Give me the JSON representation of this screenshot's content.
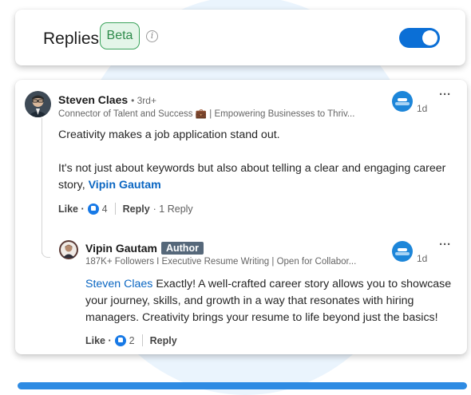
{
  "replies": {
    "title": "Replies",
    "badge": "Beta",
    "info_icon": "info-icon",
    "toggle_on": true,
    "toggle_color": "#0b6fd6"
  },
  "comment": {
    "author": "Steven Claes",
    "degree": "• 3rd+",
    "headline": "Connector of Talent and Success 💼 | Empowering Businesses to Thriv...",
    "time": "1d",
    "more": "···",
    "text_1": "Creativity makes a job application stand out.",
    "text_2": "It's not just about keywords but also about telling a clear and engaging career story,",
    "mention": "Vipin Gautam",
    "like_label": "Like ·",
    "like_count": "4",
    "reply_label": "Reply",
    "reply_count": "· 1 Reply"
  },
  "reply": {
    "author": "Vipin Gautam",
    "badge": "Author",
    "headline": "187K+ Followers I Executive Resume Writing | Open for Collabor...",
    "time": "1d",
    "more": "···",
    "mention": "Steven Claes",
    "text": "Exactly! A well-crafted career story allows you to showcase your journey, skills, and growth in a way that resonates with hiring managers. Creativity brings your resume to life beyond just the basics!",
    "like_label": "Like ·",
    "like_count": "2",
    "reply_label": "Reply"
  },
  "colors": {
    "accent": "#0a66c2",
    "beta_border": "#3ca35c",
    "author_badge": "#56687a"
  }
}
